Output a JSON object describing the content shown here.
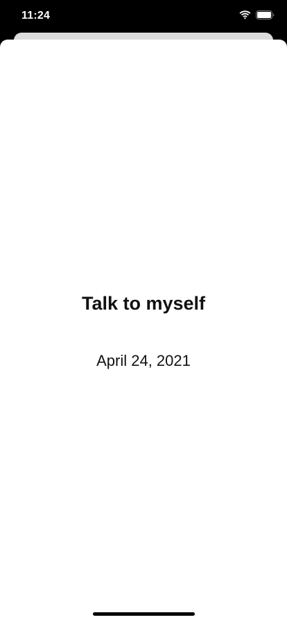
{
  "status_bar": {
    "time": "11:24",
    "icons": [
      "wifi-icon",
      "battery-icon"
    ]
  },
  "content": {
    "title": "Talk to myself",
    "date": "April 24, 2021"
  },
  "colors": {
    "background": "#000000",
    "sheet": "#ffffff",
    "back_card": "#dcdcdc",
    "text": "#111111"
  }
}
